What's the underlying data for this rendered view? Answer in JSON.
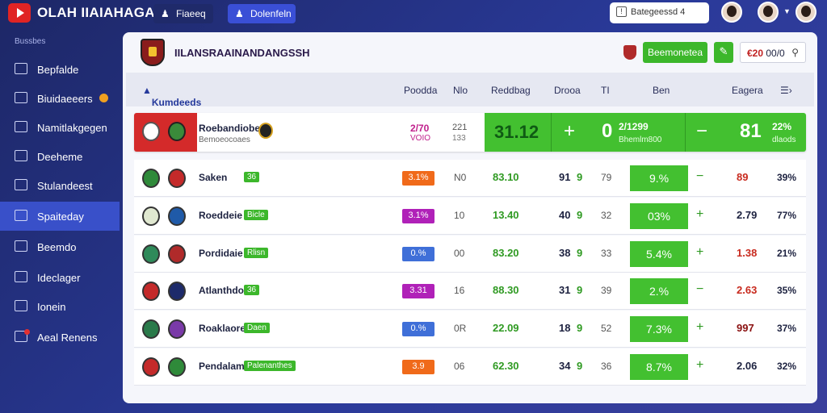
{
  "app": {
    "title": "OLAH IIAIAHAGAN"
  },
  "top_tabs": [
    {
      "label": "Fiaeeq",
      "icon": "user-icon"
    },
    {
      "label": "Dolenfeln",
      "icon": "person-icon"
    }
  ],
  "search": {
    "placeholder": "Bategeessd 4"
  },
  "sidebar": {
    "heading": "Bussbes",
    "items": [
      {
        "label": "Bepfalde"
      },
      {
        "label": "Biuidaeeers"
      },
      {
        "label": "Namitlakgegen"
      },
      {
        "label": "Deeheme"
      },
      {
        "label": "Stulandeest"
      },
      {
        "label": "Spaiteday"
      },
      {
        "label": "Beemdo"
      },
      {
        "label": "Ideclager"
      },
      {
        "label": "Ionein"
      },
      {
        "label": "Aeal Renens"
      }
    ]
  },
  "panel": {
    "title": "IILANSRAAINANDANGSSH",
    "primary_button": "Beemonetea",
    "edit_icon": "pencil-icon",
    "price_value": "€20",
    "price_suffix": "00/0",
    "columns": {
      "main": "Kumdeeds",
      "c1": "Poodda",
      "c2": "Nlo",
      "c3": "Reddbag",
      "c4": "Drooa",
      "c5": "TI",
      "c6": "Ben",
      "c7": "Eagera"
    }
  },
  "featured": {
    "team": "Roebandiobes",
    "subtitle": "Bemoeocoaes",
    "pink_top": "2/70",
    "pink_bottom": "VOIO",
    "gray_top": "221",
    "gray_bottom": "133",
    "score": "31.12",
    "plus": "+",
    "zero": "0",
    "odds_top": "2/1299",
    "odds_bottom": "Bhemlm800",
    "minus": "−",
    "right_value": "81",
    "right_pct": "22%",
    "right_sub": "dlaods"
  },
  "rows": [
    {
      "team": "Saken",
      "tag": "36",
      "pill": "3.1%",
      "pill_color": "#f06a1a",
      "n": "N0",
      "score": "83.10",
      "a": "91",
      "b": "9",
      "c": "79",
      "pct": "9.%",
      "sign": "−",
      "val": "89",
      "val_color": "#c82a1e",
      "share": "39%"
    },
    {
      "team": "Roeddeie",
      "tag": "Bicle",
      "pill": "3.1%",
      "pill_color": "#b021b8",
      "n": "10",
      "score": "13.40",
      "a": "40",
      "b": "9",
      "c": "32",
      "pct": "03%",
      "sign": "+",
      "val": "2.79",
      "val_color": "#1d2240",
      "share": "77%"
    },
    {
      "team": "Pordidaie",
      "tag": "Rlisn",
      "pill": "0.%",
      "pill_color": "#3f6fd8",
      "n": "00",
      "score": "83.20",
      "a": "38",
      "b": "9",
      "c": "33",
      "pct": "5.4%",
      "sign": "+",
      "val": "1.38",
      "val_color": "#c82a1e",
      "share": "21%"
    },
    {
      "team": "Atlanthdos",
      "tag": "36",
      "pill": "3.31",
      "pill_color": "#b021b8",
      "n": "16",
      "score": "88.30",
      "a": "31",
      "b": "9",
      "c": "39",
      "pct": "2.%",
      "sign": "−",
      "val": "2.63",
      "val_color": "#c82a1e",
      "share": "35%"
    },
    {
      "team": "Roaklaore",
      "tag": "Daen",
      "pill": "0.%",
      "pill_color": "#3f6fd8",
      "n": "0R",
      "score": "22.09",
      "a": "18",
      "b": "9",
      "c": "52",
      "pct": "7.3%",
      "sign": "+",
      "val": "997",
      "val_color": "#8a1010",
      "share": "37%"
    },
    {
      "team": "Pendalam",
      "tag": "Palenanthes",
      "pill": "3.9",
      "pill_color": "#f06a1a",
      "n": "06",
      "score": "62.30",
      "a": "34",
      "b": "9",
      "c": "36",
      "pct": "8.7%",
      "sign": "+",
      "val": "2.06",
      "val_color": "#1d2240",
      "share": "32%"
    }
  ]
}
